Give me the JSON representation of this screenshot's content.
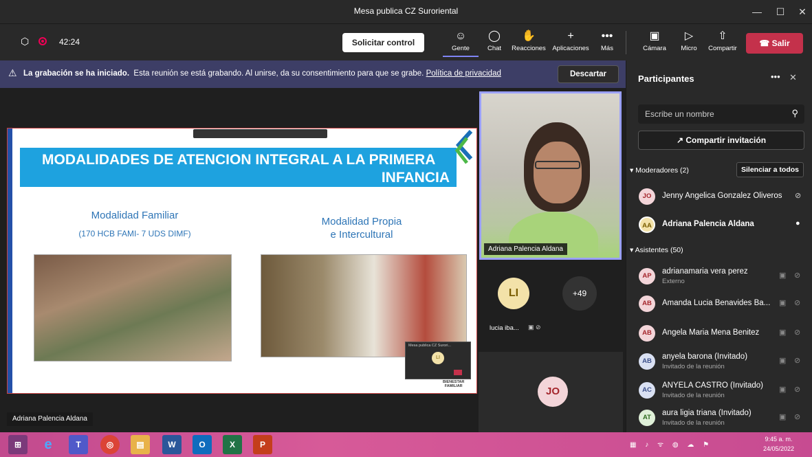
{
  "window": {
    "title": "Mesa publica CZ Suroriental"
  },
  "toolbar": {
    "timer": "42:24",
    "solicitar": "Solicitar control",
    "gente": "Gente",
    "chat": "Chat",
    "reacciones": "Reacciones",
    "aplicaciones": "Aplicaciones",
    "mas": "Más",
    "camara": "Cámara",
    "micro": "Micro",
    "compartir": "Compartir",
    "salir": "Salir"
  },
  "banner": {
    "bold": "La grabación se ha iniciado.",
    "text": "Esta reunión se está grabando. Al unirse, da su consentimiento para que se grabe.",
    "link": "Política de privacidad",
    "dismiss": "Descartar"
  },
  "slide": {
    "title_line1": "MODALIDADES DE ATENCION INTEGRAL A LA PRIMERA",
    "title_line2": "INFANCIA",
    "left_heading": "Modalidad Familiar",
    "left_sub": "(170 HCB FAMI- 7 UDS DIMF)",
    "right_heading_1": "Modalidad Propia",
    "right_heading_2": "e Intercultural",
    "mini_header": "Mesa publica CZ Surori...",
    "mini_avatar": "LI",
    "footer_logo_1": "BIENESTAR",
    "footer_logo_2": "FAMILIAR"
  },
  "video": {
    "main_name": "Adriana Palencia Aldana",
    "li_initials": "LI",
    "li_name": "lucia iba...",
    "more_count": "+49",
    "jo_initials": "JO",
    "presenter_label": "Adriana Palencia Aldana"
  },
  "panel": {
    "title": "Participantes",
    "search_placeholder": "Escribe un nombre",
    "invite": "Compartir invitación",
    "moderators_label": "Moderadores (2)",
    "mute_all": "Silenciar a todos",
    "attendees_label": "Asistentes (50)",
    "moderators": [
      {
        "initials": "JO",
        "name": "Jenny Angelica Gonzalez Oliveros"
      },
      {
        "initials": "AA",
        "name": "Adriana Palencia Aldana"
      }
    ],
    "attendees": [
      {
        "initials": "AP",
        "name": "adrianamaria vera perez",
        "sub": "Externo"
      },
      {
        "initials": "AB",
        "name": "Amanda Lucia Benavides Ba...",
        "sub": ""
      },
      {
        "initials": "AB",
        "name": "Angela Maria Mena Benitez",
        "sub": ""
      },
      {
        "initials": "AB",
        "name": "anyela barona (Invitado)",
        "sub": "Invitado de la reunión"
      },
      {
        "initials": "AC",
        "name": "ANYELA CASTRO (Invitado)",
        "sub": "Invitado de la reunión"
      },
      {
        "initials": "AT",
        "name": "aura ligia triana (Invitado)",
        "sub": "Invitado de la reunión"
      }
    ]
  },
  "taskbar": {
    "time": "9:45 a. m.",
    "date": "24/05/2022"
  }
}
